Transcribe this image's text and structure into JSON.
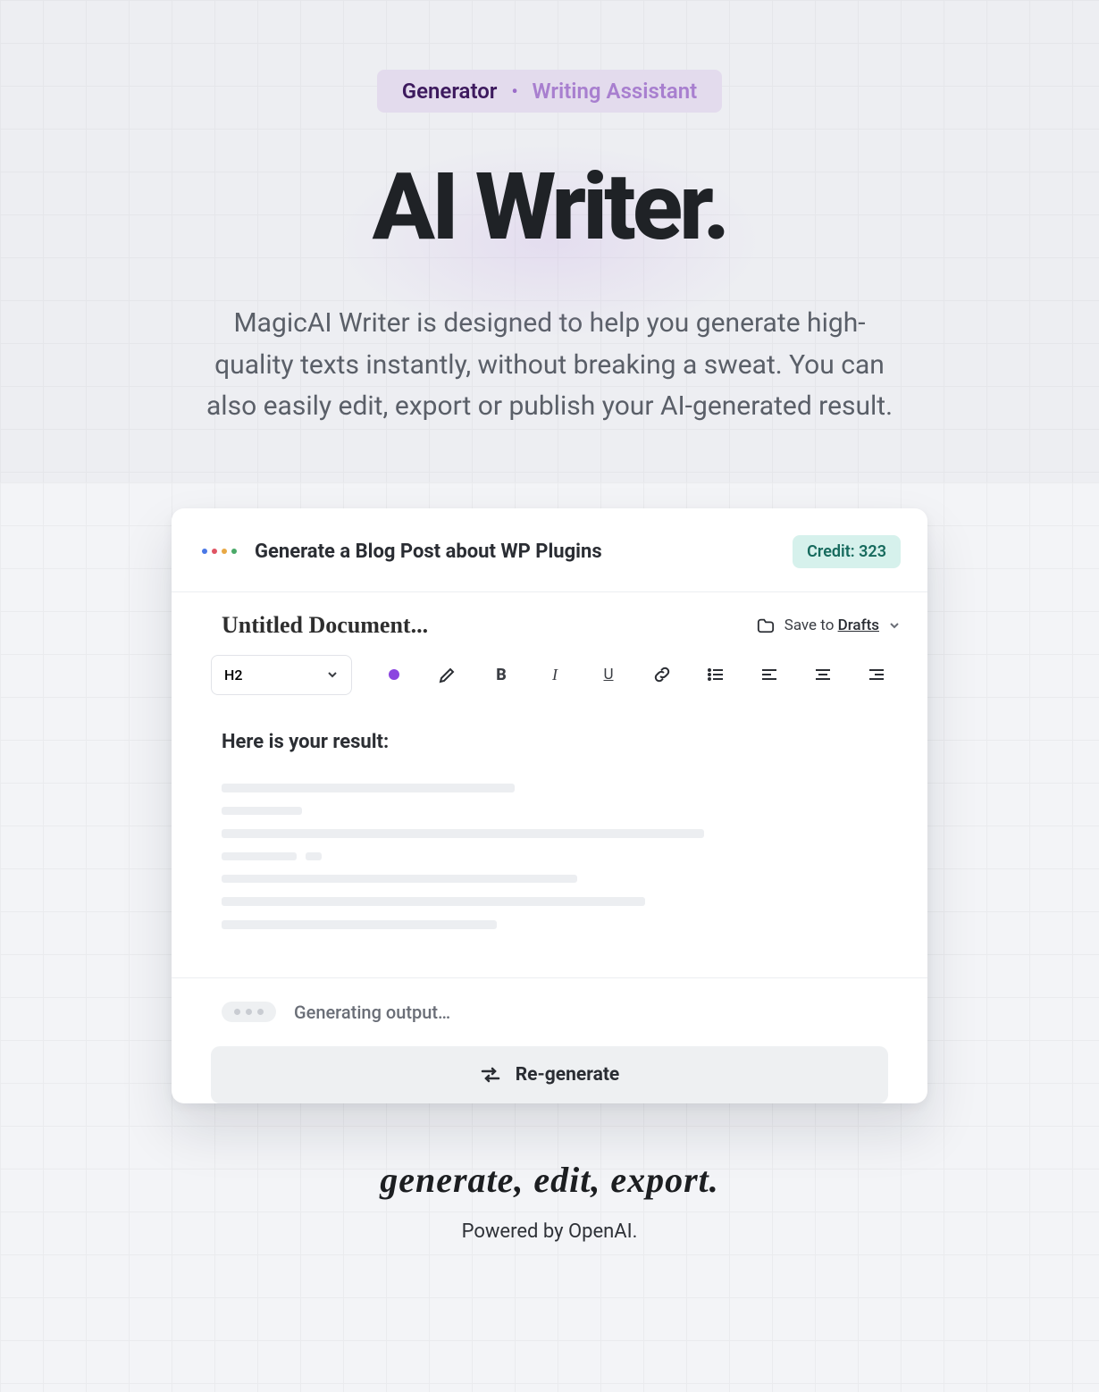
{
  "pill": {
    "active": "Generator",
    "separator": "•",
    "inactive": "Writing Assistant"
  },
  "hero": {
    "title": "AI Writer.",
    "desc": "MagicAI Writer is designed to help you generate high-quality texts instantly, without breaking a sweat. You can also easily edit, export or publish your AI-generated result."
  },
  "card": {
    "header_title": "Generate a Blog Post about WP Plugins",
    "credit_label": "Credit: 323",
    "doc_title": "Untitled Document...",
    "save_prefix": "Save to ",
    "drafts_label": "Drafts",
    "style_select": "H2",
    "result_title": "Here is your result:",
    "generating_text": "Generating output…",
    "regenerate_label": "Re-generate"
  },
  "toolbar_icons": [
    "color",
    "highlight",
    "bold",
    "italic",
    "underline",
    "link",
    "list",
    "align-left",
    "align-center",
    "align-right"
  ],
  "footer": {
    "tagline": "generate, edit, export.",
    "powered": "Powered by OpenAI."
  },
  "colors": {
    "accent": "#8b44e0",
    "badge_bg": "#d6f1ec",
    "badge_text": "#166a5d",
    "pill_bg": "#e3dbed"
  }
}
